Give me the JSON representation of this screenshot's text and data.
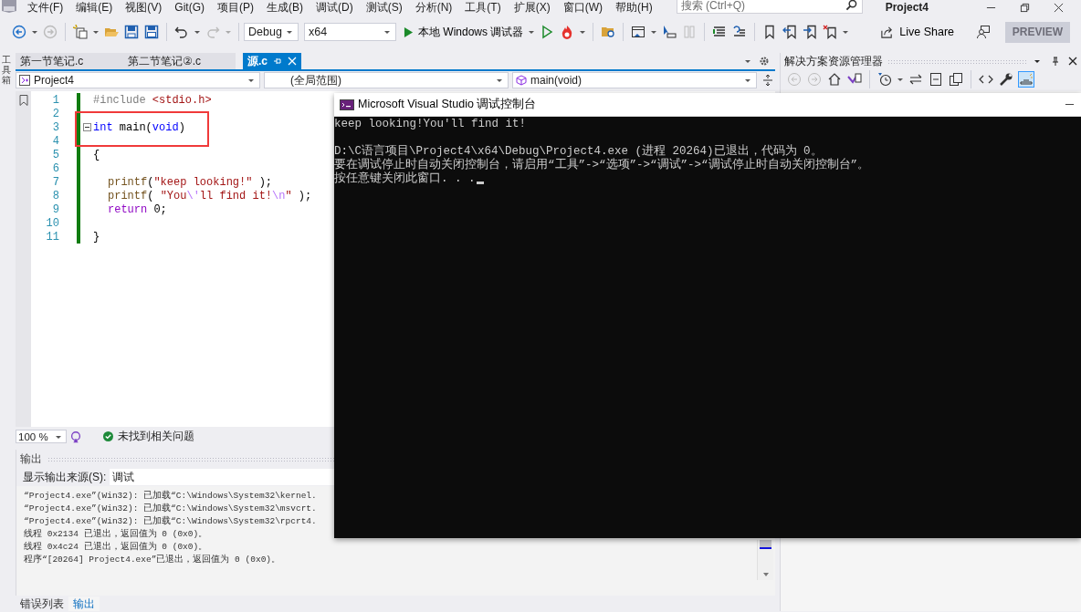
{
  "menu": [
    "文件(F)",
    "编辑(E)",
    "视图(V)",
    "Git(G)",
    "项目(P)",
    "生成(B)",
    "调试(D)",
    "测试(S)",
    "分析(N)",
    "工具(T)",
    "扩展(X)",
    "窗口(W)",
    "帮助(H)"
  ],
  "search": {
    "placeholder": "搜索 (Ctrl+Q)"
  },
  "window_title": "Project4",
  "toolbar": {
    "configuration": "Debug",
    "platform": "x64",
    "run_label": "本地 Windows 调试器",
    "live_share": "Live Share",
    "preview": "PREVIEW"
  },
  "toolbox_label": "工具箱",
  "tabs": [
    {
      "label": "第一节笔记.c",
      "selected": false
    },
    {
      "label": "第二节笔记②.c",
      "selected": false
    },
    {
      "label": "源.c",
      "selected": true
    }
  ],
  "nav": {
    "project": "Project4",
    "scope": "(全局范围)",
    "member": "main(void)"
  },
  "code_lines": [
    {
      "number": "1",
      "nested": false,
      "fold": false,
      "tokens": [
        {
          "text": "#include ",
          "kind": "directive"
        },
        {
          "text": "<stdio.h>",
          "kind": "header"
        }
      ]
    },
    {
      "number": "2"
    },
    {
      "number": "3",
      "nested": false,
      "fold": true,
      "tokens": [
        {
          "text": "int",
          "kind": "keyword"
        },
        {
          "text": " main(",
          "kind": "plain"
        },
        {
          "text": "void",
          "kind": "keyword"
        },
        {
          "text": ")",
          "kind": "plain"
        }
      ]
    },
    {
      "number": "4"
    },
    {
      "number": "5",
      "nested": false,
      "fold": false,
      "tokens": [
        {
          "text": "{",
          "kind": "plain"
        }
      ]
    },
    {
      "number": "6"
    },
    {
      "number": "7",
      "nested": true,
      "fold": false,
      "tokens": [
        {
          "text": "printf",
          "kind": "func"
        },
        {
          "text": "(",
          "kind": "plain"
        },
        {
          "text": "\"keep looking!\"",
          "kind": "string"
        },
        {
          "text": " );",
          "kind": "plain"
        }
      ]
    },
    {
      "number": "8",
      "nested": true,
      "fold": false,
      "tokens": [
        {
          "text": "printf",
          "kind": "func"
        },
        {
          "text": "( ",
          "kind": "plain"
        },
        {
          "text": "\"You",
          "kind": "string"
        },
        {
          "text": "\\'",
          "kind": "escape"
        },
        {
          "text": "ll find it!",
          "kind": "string"
        },
        {
          "text": "\\n",
          "kind": "escape"
        },
        {
          "text": "\"",
          "kind": "string"
        },
        {
          "text": " );",
          "kind": "plain"
        }
      ]
    },
    {
      "number": "9",
      "nested": true,
      "fold": false,
      "tokens": [
        {
          "text": "return",
          "kind": "control"
        },
        {
          "text": " 0;",
          "kind": "plain"
        }
      ]
    },
    {
      "number": "10"
    },
    {
      "number": "11",
      "nested": false,
      "fold": false,
      "tokens": [
        {
          "text": "}",
          "kind": "plain"
        }
      ]
    }
  ],
  "status": {
    "zoom": "100 %",
    "issues": "未找到相关问题"
  },
  "output": {
    "title": "输出",
    "source_label": "显示输出来源(S):",
    "source": "调试",
    "lines": [
      "“Project4.exe”(Win32): 已加载“C:\\Windows\\System32\\kernel.",
      "“Project4.exe”(Win32): 已加载“C:\\Windows\\System32\\msvcrt.",
      "“Project4.exe”(Win32): 已加载“C:\\Windows\\System32\\rpcrt4.",
      "线程 0x2134 已退出，返回值为 0 (0x0)。",
      "线程 0x4c24 已退出，返回值为 0 (0x0)。",
      "程序“[20264] Project4.exe”已退出，返回值为 0 (0x0)。"
    ]
  },
  "bottom_tabs": [
    {
      "label": "错误列表",
      "selected": false
    },
    {
      "label": "输出",
      "selected": true
    }
  ],
  "solution_explorer": {
    "title": "解决方案资源管理器"
  },
  "console": {
    "title": "Microsoft Visual Studio 调试控制台",
    "paragraphs": [
      [
        "keep looking!You'll find it!"
      ],
      [
        "D:\\C语言项目\\Project4\\x64\\Debug\\Project4.exe (进程 20264)已退出，代码为 0。",
        "要在调试停止时自动关闭控制台，请启用“工具”->“选项”->“调试”->“调试停止时自动关闭控制台”。",
        "按任意键关闭此窗口. . ."
      ]
    ],
    "cursor": true
  }
}
